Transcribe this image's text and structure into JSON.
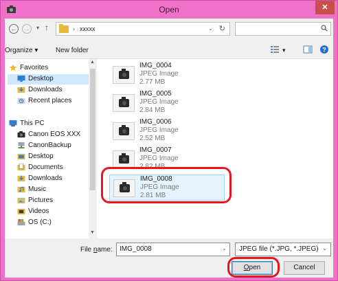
{
  "window": {
    "title": "Open",
    "close_glyph": "✕"
  },
  "navigation": {
    "back_glyph": "←",
    "forward_glyph": "→",
    "recent_glyph": "▾",
    "up_glyph": "↑",
    "breadcrumb_separator": "›",
    "breadcrumb": "xxxxx",
    "address_dropdown_glyph": "⌄",
    "refresh_glyph": "↻",
    "search_placeholder": ""
  },
  "toolbar": {
    "organize_label": "Organize ▾",
    "new_folder_label": "New folder",
    "view_dropdown_glyph": "▾"
  },
  "sidebar": {
    "favorites_group": "Favorites",
    "favorites": [
      {
        "label": "Desktop",
        "icon": "desktop-icon"
      },
      {
        "label": "Downloads",
        "icon": "downloads-icon"
      },
      {
        "label": "Recent places",
        "icon": "recent-places-icon"
      }
    ],
    "pc_group": "This PC",
    "pc_items": [
      {
        "label": "Canon EOS XXX",
        "icon": "camera-icon"
      },
      {
        "label": "CanonBackup",
        "icon": "network-drive-icon"
      },
      {
        "label": "Desktop",
        "icon": "desktop-folder-icon"
      },
      {
        "label": "Documents",
        "icon": "documents-icon"
      },
      {
        "label": "Downloads",
        "icon": "downloads-icon"
      },
      {
        "label": "Music",
        "icon": "music-icon"
      },
      {
        "label": "Pictures",
        "icon": "pictures-icon"
      },
      {
        "label": "Videos",
        "icon": "videos-icon"
      },
      {
        "label": "OS (C:)",
        "icon": "drive-icon"
      }
    ],
    "scroll_up_glyph": "▲",
    "scroll_down_glyph": "▼"
  },
  "files": [
    {
      "name": "IMG_0004",
      "type": "JPEG Image",
      "size": "2.77 MB",
      "selected": false
    },
    {
      "name": "IMG_0005",
      "type": "JPEG Image",
      "size": "2.84 MB",
      "selected": false
    },
    {
      "name": "IMG_0006",
      "type": "JPEG Image",
      "size": "2.52 MB",
      "selected": false
    },
    {
      "name": "IMG_0007",
      "type": "JPEG Image",
      "size": "2.82 MB",
      "selected": false
    },
    {
      "name": "IMG_0008",
      "type": "JPEG Image",
      "size": "2.81 MB",
      "selected": true
    }
  ],
  "bottom": {
    "file_name_label_pre": "File ",
    "file_name_label_access": "n",
    "file_name_label_post": "ame:",
    "file_name_value": "IMG_0008",
    "file_name_dropdown_glyph": "⌄",
    "file_type_value": "JPEG file (*.JPG, *.JPEG)",
    "file_type_dropdown_glyph": "⌄",
    "open_label_access": "O",
    "open_label_rest": "pen",
    "cancel_label": "Cancel"
  },
  "colors": {
    "titlebar": "#f072c8",
    "close_button": "#c7504a",
    "selection": "#e5f3ff",
    "highlight": "#e8141e"
  }
}
